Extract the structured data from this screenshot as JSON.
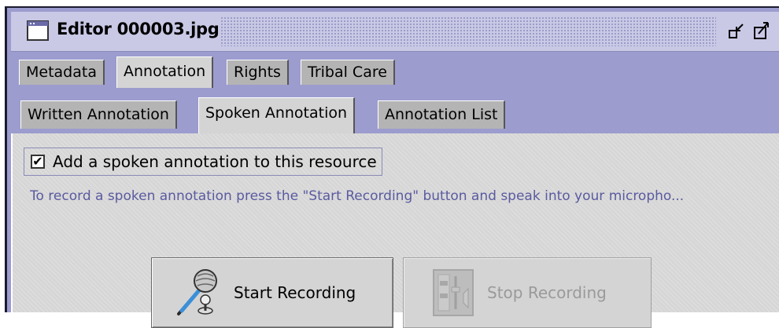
{
  "window": {
    "title": "Editor 000003.jpg",
    "controls": [
      "minimize-icon",
      "maximize-icon"
    ]
  },
  "tabs": [
    {
      "label": "Metadata",
      "active": false
    },
    {
      "label": "Annotation",
      "active": true
    },
    {
      "label": "Rights",
      "active": false
    },
    {
      "label": "Tribal Care",
      "active": false
    }
  ],
  "subtabs": [
    {
      "label": "Written Annotation",
      "active": false
    },
    {
      "label": "Spoken Annotation",
      "active": true
    },
    {
      "label": "Annotation List",
      "active": false
    }
  ],
  "spoken": {
    "checkbox_label": "Add a spoken annotation to this resource",
    "checked": true,
    "hint": "To record a spoken annotation press the \"Start Recording\" button and speak into your micropho...",
    "start_button": "Start Recording",
    "stop_button": "Stop Recording",
    "stop_enabled": false,
    "start_icon": "microphone-icon",
    "stop_icon": "mixer-icon"
  },
  "colors": {
    "chrome": "#9c9ccf",
    "titlebar": "#c9c9e6",
    "panel": "#d4d4d4",
    "hint_text": "#5a5aa0"
  }
}
